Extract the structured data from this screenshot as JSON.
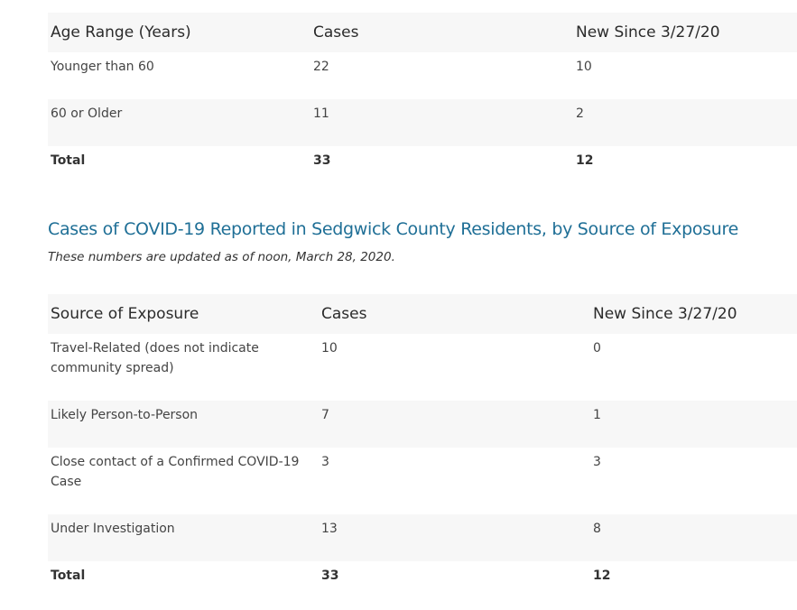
{
  "age_table": {
    "headers": [
      "Age Range (Years)",
      "Cases",
      "New Since 3/27/20"
    ],
    "rows": [
      [
        "Younger than 60",
        "22",
        "10"
      ],
      [
        "60 or Older",
        "11",
        "2"
      ],
      [
        "Total",
        "33",
        "12"
      ]
    ]
  },
  "exposure_section": {
    "title": "Cases of COVID-19 Reported in Sedgwick County Residents, by Source of Exposure",
    "note": "These numbers are updated as of noon, March 28, 2020."
  },
  "exposure_table": {
    "headers": [
      "Source of Exposure",
      "Cases",
      "New Since 3/27/20"
    ],
    "rows": [
      [
        "Travel-Related (does not indicate community spread)",
        "10",
        "0"
      ],
      [
        "Likely Person-to-Person",
        "7",
        "1"
      ],
      [
        "Close contact of a Confirmed COVID-19 Case",
        "3",
        "3"
      ],
      [
        "Under Investigation",
        "13",
        "8"
      ],
      [
        "Total",
        "33",
        "12"
      ]
    ]
  }
}
